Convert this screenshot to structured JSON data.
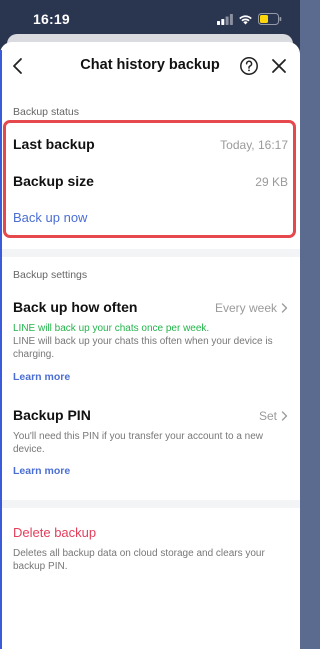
{
  "status_bar": {
    "time": "16:19"
  },
  "header": {
    "title": "Chat history backup"
  },
  "backup_status": {
    "section_label": "Backup status",
    "last_backup_label": "Last backup",
    "last_backup_value": "Today, 16:17",
    "backup_size_label": "Backup size",
    "backup_size_value": "29 KB",
    "back_up_now_label": "Back up now"
  },
  "backup_settings": {
    "section_label": "Backup settings",
    "how_often_label": "Back up how often",
    "how_often_value": "Every week",
    "how_often_note": "LINE will back up your chats once per week.",
    "how_often_desc": "LINE will back up your chats this often when your device is charging.",
    "learn_more_1": "Learn more",
    "pin_label": "Backup PIN",
    "pin_value": "Set",
    "pin_desc": "You'll need this PIN if you transfer your account to a new device.",
    "learn_more_2": "Learn more"
  },
  "delete": {
    "label": "Delete backup",
    "desc": "Deletes all backup data on cloud storage and clears your backup PIN."
  },
  "colors": {
    "accent_link": "#4a6ed3",
    "highlight_border": "#e5484d",
    "delete_red": "#e53e5a",
    "note_green": "#22b44a"
  },
  "icons": [
    "back-icon",
    "help-icon",
    "close-icon",
    "chevron-right-icon",
    "wifi-icon",
    "signal-icon",
    "battery-icon"
  ]
}
